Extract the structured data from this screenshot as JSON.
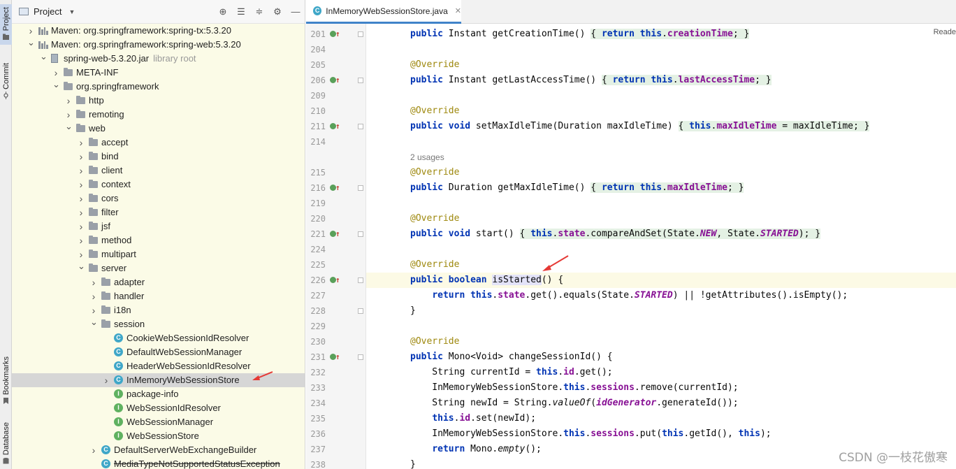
{
  "toolstrip": {
    "project_label": "Project",
    "commit_label": "Commit",
    "bookmarks_label": "Bookmarks",
    "database_label": "Database"
  },
  "project_panel": {
    "title": "Project"
  },
  "tree": [
    {
      "indent": 0,
      "expanded": false,
      "icon": "maven",
      "label": "Maven: org.springframework:spring-tx:5.3.20"
    },
    {
      "indent": 0,
      "expanded": true,
      "icon": "maven",
      "label": "Maven: org.springframework:spring-web:5.3.20"
    },
    {
      "indent": 1,
      "expanded": true,
      "icon": "jar",
      "label": "spring-web-5.3.20.jar",
      "extra": "library root"
    },
    {
      "indent": 2,
      "expanded": false,
      "icon": "folder",
      "label": "META-INF"
    },
    {
      "indent": 2,
      "expanded": true,
      "icon": "folder",
      "label": "org.springframework"
    },
    {
      "indent": 3,
      "expanded": false,
      "icon": "folder",
      "label": "http"
    },
    {
      "indent": 3,
      "expanded": false,
      "icon": "folder",
      "label": "remoting"
    },
    {
      "indent": 3,
      "expanded": true,
      "icon": "folder",
      "label": "web"
    },
    {
      "indent": 4,
      "expanded": false,
      "icon": "folder",
      "label": "accept"
    },
    {
      "indent": 4,
      "expanded": false,
      "icon": "folder",
      "label": "bind"
    },
    {
      "indent": 4,
      "expanded": false,
      "icon": "folder",
      "label": "client"
    },
    {
      "indent": 4,
      "expanded": false,
      "icon": "folder",
      "label": "context"
    },
    {
      "indent": 4,
      "expanded": false,
      "icon": "folder",
      "label": "cors"
    },
    {
      "indent": 4,
      "expanded": false,
      "icon": "folder",
      "label": "filter"
    },
    {
      "indent": 4,
      "expanded": false,
      "icon": "folder",
      "label": "jsf"
    },
    {
      "indent": 4,
      "expanded": false,
      "icon": "folder",
      "label": "method"
    },
    {
      "indent": 4,
      "expanded": false,
      "icon": "folder",
      "label": "multipart"
    },
    {
      "indent": 4,
      "expanded": true,
      "icon": "folder",
      "label": "server"
    },
    {
      "indent": 5,
      "expanded": false,
      "icon": "folder",
      "label": "adapter"
    },
    {
      "indent": 5,
      "expanded": false,
      "icon": "folder",
      "label": "handler"
    },
    {
      "indent": 5,
      "expanded": false,
      "icon": "folder",
      "label": "i18n"
    },
    {
      "indent": 5,
      "expanded": true,
      "icon": "folder",
      "label": "session"
    },
    {
      "indent": 6,
      "leaf": true,
      "icon": "class",
      "label": "CookieWebSessionIdResolver"
    },
    {
      "indent": 6,
      "leaf": true,
      "icon": "class",
      "label": "DefaultWebSessionManager"
    },
    {
      "indent": 6,
      "leaf": true,
      "icon": "class",
      "label": "HeaderWebSessionIdResolver"
    },
    {
      "indent": 6,
      "expanded": false,
      "icon": "class",
      "label": "InMemoryWebSessionStore",
      "selected": true
    },
    {
      "indent": 6,
      "leaf": true,
      "icon": "interface",
      "label": "package-info"
    },
    {
      "indent": 6,
      "leaf": true,
      "icon": "interface",
      "label": "WebSessionIdResolver"
    },
    {
      "indent": 6,
      "leaf": true,
      "icon": "interface",
      "label": "WebSessionManager"
    },
    {
      "indent": 6,
      "leaf": true,
      "icon": "interface",
      "label": "WebSessionStore"
    },
    {
      "indent": 5,
      "expanded": false,
      "icon": "class",
      "label": "DefaultServerWebExchangeBuilder"
    },
    {
      "indent": 5,
      "leaf": true,
      "icon": "class",
      "label": "MediaTypeNotSupportedStatusException",
      "strike": true
    }
  ],
  "editor": {
    "tab_label": "InMemoryWebSessionStore.java",
    "reader_mode": "Reade",
    "lines": [
      {
        "num": "201",
        "override": true,
        "fold": true,
        "html": "<span class=\"kw\">public</span> Instant getCreationTime() <span class=\"fold-bg\">{ <span class=\"kw\">return</span> <span class=\"kw\">this</span>.<span class=\"fld\">creationTime</span>; }</span>"
      },
      {
        "num": "204",
        "html": ""
      },
      {
        "num": "205",
        "html": "<span class=\"an\">@Override</span>"
      },
      {
        "num": "206",
        "override": true,
        "fold": true,
        "html": "<span class=\"kw\">public</span> Instant getLastAccessTime() <span class=\"fold-bg\">{ <span class=\"kw\">return</span> <span class=\"kw\">this</span>.<span class=\"fld\">lastAccessTime</span>; }</span>"
      },
      {
        "num": "209",
        "html": ""
      },
      {
        "num": "210",
        "html": "<span class=\"an\">@Override</span>"
      },
      {
        "num": "211",
        "override": true,
        "fold": true,
        "html": "<span class=\"kw\">public void</span> setMaxIdleTime(Duration maxIdleTime) <span class=\"fold-bg\">{ <span class=\"kw\">this</span>.<span class=\"fld\">maxIdleTime</span> = maxIdleTime; }</span>"
      },
      {
        "num": "214",
        "html": ""
      },
      {
        "num": "",
        "usages": true,
        "html": "2 usages"
      },
      {
        "num": "215",
        "html": "<span class=\"an\">@Override</span>"
      },
      {
        "num": "216",
        "override": true,
        "fold": true,
        "html": "<span class=\"kw\">public</span> Duration getMaxIdleTime() <span class=\"fold-bg\">{ <span class=\"kw\">return</span> <span class=\"kw\">this</span>.<span class=\"fld\">maxIdleTime</span>; }</span>"
      },
      {
        "num": "219",
        "html": ""
      },
      {
        "num": "220",
        "html": "<span class=\"an\">@Override</span>"
      },
      {
        "num": "221",
        "override": true,
        "fold": true,
        "html": "<span class=\"kw\">public void</span> start() <span class=\"fold-bg\">{ <span class=\"kw\">this</span>.<span class=\"fld\">state</span>.compareAndSet(State.<span class=\"fi\">NEW</span>, State.<span class=\"fi\">STARTED</span>); }</span>"
      },
      {
        "num": "224",
        "html": ""
      },
      {
        "num": "225",
        "html": "<span class=\"an\">@Override</span>"
      },
      {
        "num": "226",
        "override": true,
        "fold": true,
        "current": true,
        "html": "<span class=\"kw\">public boolean</span> <span class=\"hl\">isStarted</span>() {"
      },
      {
        "num": "227",
        "html": "    <span class=\"kw\">return this</span>.<span class=\"fld\">state</span>.get().equals(State.<span class=\"fi\">STARTED</span>) || !getAttributes().isEmpty();"
      },
      {
        "num": "228",
        "fold": true,
        "html": "}"
      },
      {
        "num": "229",
        "html": ""
      },
      {
        "num": "230",
        "html": "<span class=\"an\">@Override</span>"
      },
      {
        "num": "231",
        "override": true,
        "fold": true,
        "html": "<span class=\"kw\">public</span> Mono&lt;Void&gt; changeSessionId() {"
      },
      {
        "num": "232",
        "html": "    String currentId = <span class=\"kw\">this</span>.<span class=\"fld\">id</span>.get();"
      },
      {
        "num": "233",
        "html": "    InMemoryWebSessionStore.<span class=\"kw\">this</span>.<span class=\"fld\">sessions</span>.remove(currentId);"
      },
      {
        "num": "234",
        "html": "    String newId = String.<span class=\"it\">valueOf</span>(<span class=\"fi\">idGenerator</span>.generateId());"
      },
      {
        "num": "235",
        "html": "    <span class=\"kw\">this</span>.<span class=\"fld\">id</span>.set(newId);"
      },
      {
        "num": "236",
        "html": "    InMemoryWebSessionStore.<span class=\"kw\">this</span>.<span class=\"fld\">sessions</span>.put(<span class=\"kw\">this</span>.getId(), <span class=\"kw\">this</span>);"
      },
      {
        "num": "237",
        "html": "    <span class=\"kw\">return</span> Mono.<span class=\"it\">empty</span>();"
      },
      {
        "num": "238",
        "html": "}"
      }
    ]
  },
  "watermark": "CSDN @一枝花傲寒",
  "colors": {
    "accent_tab": "#4083c9",
    "annotation_arrow": "#e53935",
    "project_bg": "#fbfbe7"
  }
}
